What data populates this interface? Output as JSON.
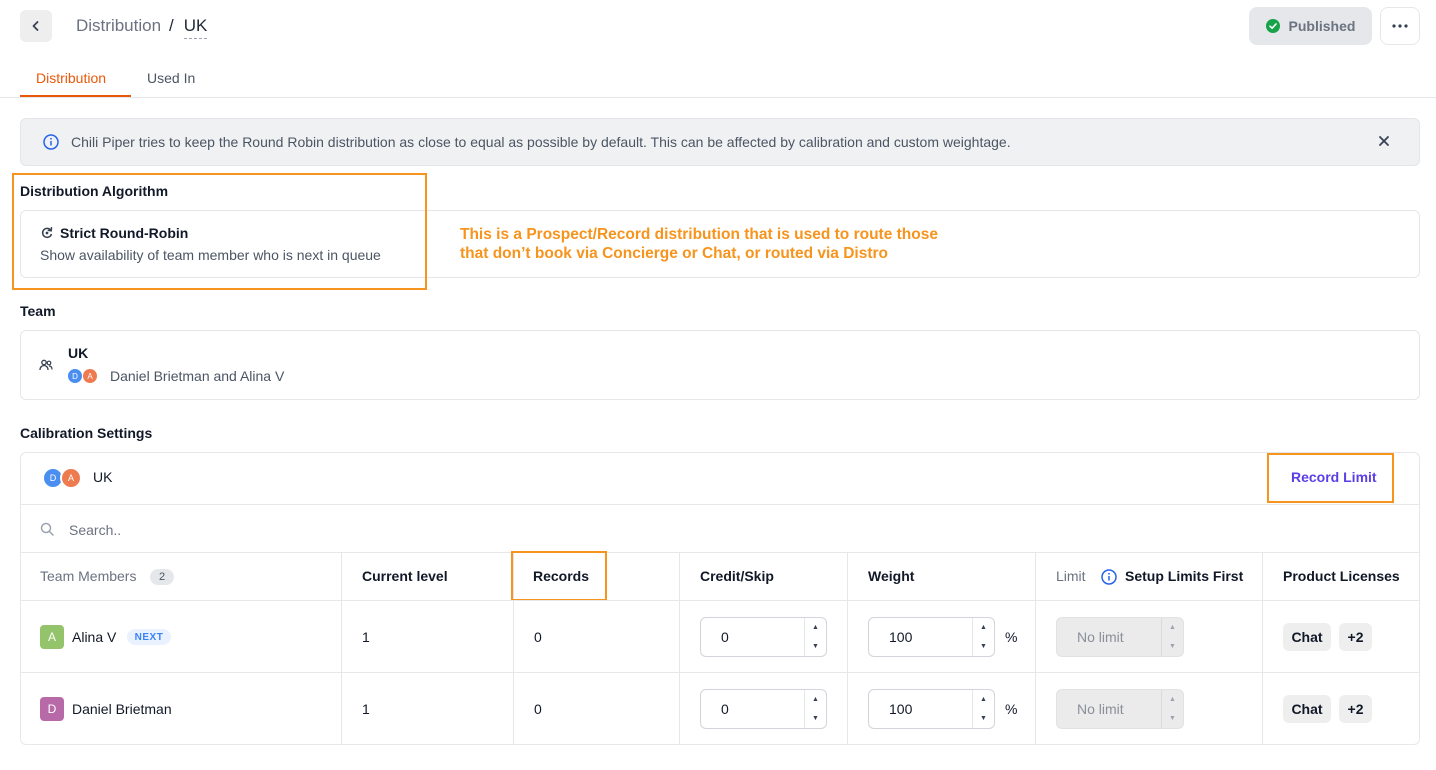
{
  "header": {
    "breadcrumb_parent": "Distribution",
    "breadcrumb_separator": "/",
    "breadcrumb_current": "UK",
    "status_label": "Published"
  },
  "tabs": [
    {
      "label": "Distribution",
      "active": true
    },
    {
      "label": "Used In",
      "active": false
    }
  ],
  "banner": {
    "text": "Chili Piper tries to keep the Round Robin distribution as close to equal as possible by default. This can be affected by calibration and custom weightage."
  },
  "algorithm": {
    "section_title": "Distribution Algorithm",
    "name": "Strict Round-Robin",
    "description": "Show availability of team member who is next in queue"
  },
  "annotation": {
    "line1": "This is a Prospect/Record distribution that is used to route those",
    "line2": "that don’t book via Concierge or Chat, or routed via Distro"
  },
  "team": {
    "section_title": "Team",
    "name": "UK",
    "members_text": "Daniel Brietman and Alina V",
    "avatars": [
      "D",
      "A"
    ]
  },
  "calibration": {
    "section_title": "Calibration Settings",
    "team_name": "UK",
    "avatars": [
      "D",
      "A"
    ],
    "record_limit_label": "Record Limit",
    "search_placeholder": "Search..",
    "columns": {
      "team_members": "Team Members",
      "member_count": "2",
      "current_level": "Current level",
      "records": "Records",
      "credit_skip": "Credit/Skip",
      "weight": "Weight",
      "limit": "Limit",
      "setup_limits": "Setup Limits First",
      "product_licenses": "Product Licenses"
    },
    "rows": [
      {
        "initial": "A",
        "avatar_color": "#93c36b",
        "name": "Alina V",
        "badge": "NEXT",
        "current_level": "1",
        "records": "0",
        "credit_skip": "0",
        "weight": "100",
        "weight_unit": "%",
        "limit": "No limit",
        "license": "Chat",
        "license_more": "+2"
      },
      {
        "initial": "D",
        "avatar_color": "#b86aa8",
        "name": "Daniel Brietman",
        "badge": "",
        "current_level": "1",
        "records": "0",
        "credit_skip": "0",
        "weight": "100",
        "weight_unit": "%",
        "limit": "No limit",
        "license": "Chat",
        "license_more": "+2"
      }
    ]
  },
  "colors": {
    "accent": "#ea580c",
    "annotation": "#f7941d",
    "link": "#5b3ee6",
    "published_check": "#16a34a"
  }
}
